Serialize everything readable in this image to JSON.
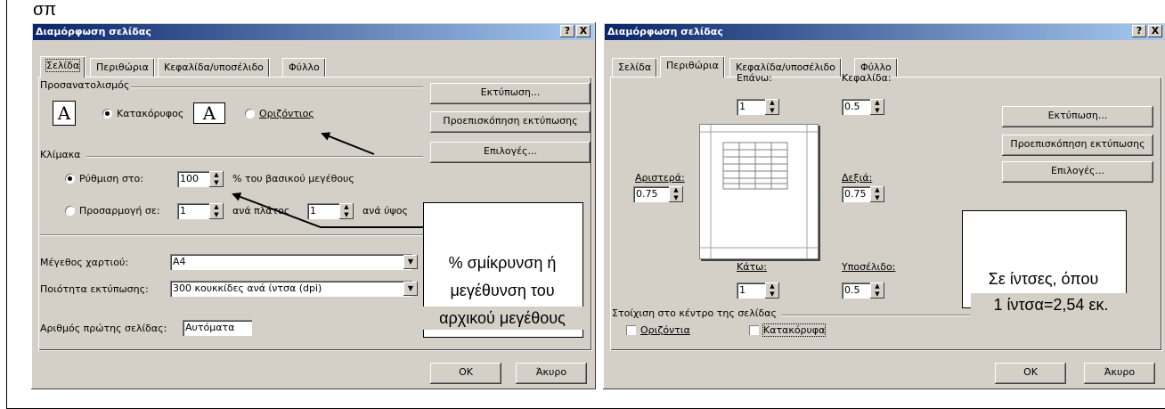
{
  "top_caption": "σπ",
  "left": {
    "title": "Διαμόρφωση σελίδας",
    "help": "?",
    "close": "X",
    "tabs": [
      "Σελίδα",
      "Περιθώρια",
      "Κεφαλίδα/υποσέλιδο",
      "Φύλλο"
    ],
    "orientation_group": "Προσανατολισμός",
    "portrait": "Κατακόρυφος",
    "landscape": "Οριζόντιος",
    "scale_group": "Κλίμακα",
    "adjust_to": "Ρύθμιση στο:",
    "adjust_value": "100",
    "adjust_suffix": "% του βασικού μεγέθους",
    "fit_to": "Προσαρμογή σε:",
    "fit_wide": "1",
    "fit_wide_label": "ανά πλάτος",
    "fit_tall": "1",
    "fit_tall_label": "ανά ύψος",
    "paper_label": "Μέγεθος χαρτιού:",
    "paper_value": "A4",
    "quality_label": "Ποιότητα εκτύπωσης:",
    "quality_value": "300 κουκκίδες ανά ίντσα (dpi)",
    "first_page_label": "Αριθμός πρώτης σελίδας:",
    "first_page_value": "Αυτόματα",
    "btn_print": "Εκτύπωση...",
    "btn_preview": "Προεπισκόπηση εκτύπωσης",
    "btn_options": "Επιλογές...",
    "btn_ok": "OK",
    "btn_cancel": "Άκυρο",
    "annotation_1": "% σμίκρυνση ή",
    "annotation_2": "μεγέθυνση του",
    "annotation_3": "αρχικού μεγέθους"
  },
  "right": {
    "title": "Διαμόρφωση σελίδας",
    "help": "?",
    "close": "X",
    "tabs": [
      "Σελίδα",
      "Περιθώρια",
      "Κεφαλίδα/υποσέλιδο",
      "Φύλλο"
    ],
    "top_label": "Επάνω:",
    "top_value": "1",
    "header_label": "Κεφαλίδα:",
    "header_value": "0.5",
    "left_label": "Αριστερά:",
    "left_value": "0.75",
    "right_label": "Δεξιά:",
    "right_value": "0.75",
    "bottom_label": "Κάτω:",
    "bottom_value": "1",
    "footer_label": "Υποσέλιδο:",
    "footer_value": "0.5",
    "center_group": "Στοίχιση στο κέντρο της σελίδας",
    "horizontal": "Οριζόντια",
    "vertical": "Κατακόρυφα",
    "btn_print": "Εκτύπωση...",
    "btn_preview": "Προεπισκόπηση εκτύπωσης",
    "btn_options": "Επιλογές...",
    "btn_ok": "OK",
    "btn_cancel": "Άκυρο",
    "annotation_1": "Σε ίντσες, όπου",
    "annotation_2": "1 ίντσα=2,54 εκ."
  }
}
